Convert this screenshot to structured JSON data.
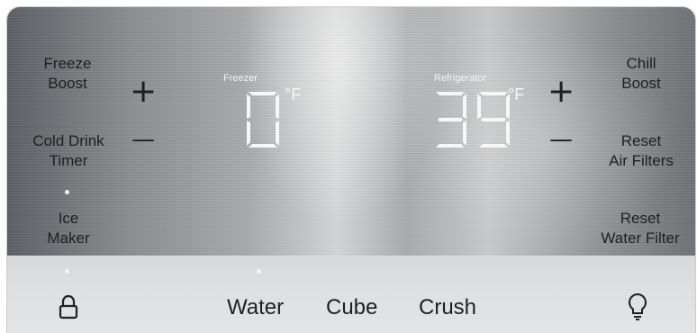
{
  "left_controls": {
    "freeze_boost": "Freeze\nBoost",
    "cold_drink_timer": "Cold Drink\nTimer",
    "ice_maker": "Ice\nMaker"
  },
  "right_controls": {
    "chill_boost": "Chill\nBoost",
    "reset_air_filters": "Reset\nAir Filters",
    "reset_water_filter": "Reset\nWater Filter"
  },
  "freezer": {
    "label": "Freezer",
    "temperature": "0",
    "unit": "°F"
  },
  "refrigerator": {
    "label": "Refrigerator",
    "temperature": "39",
    "unit": "°F"
  },
  "buttons": {
    "plus": "+",
    "minus": "—"
  },
  "bottom": {
    "water": "Water",
    "cube": "Cube",
    "crush": "Crush"
  },
  "icons": [
    "lock-icon",
    "light-bulb-icon"
  ],
  "indicators": {
    "ice_maker_on": true,
    "lock_on": true,
    "water_selected": true
  },
  "colors": {
    "display_digit": "#f7f7f7",
    "label_text": "#1d1f22"
  }
}
